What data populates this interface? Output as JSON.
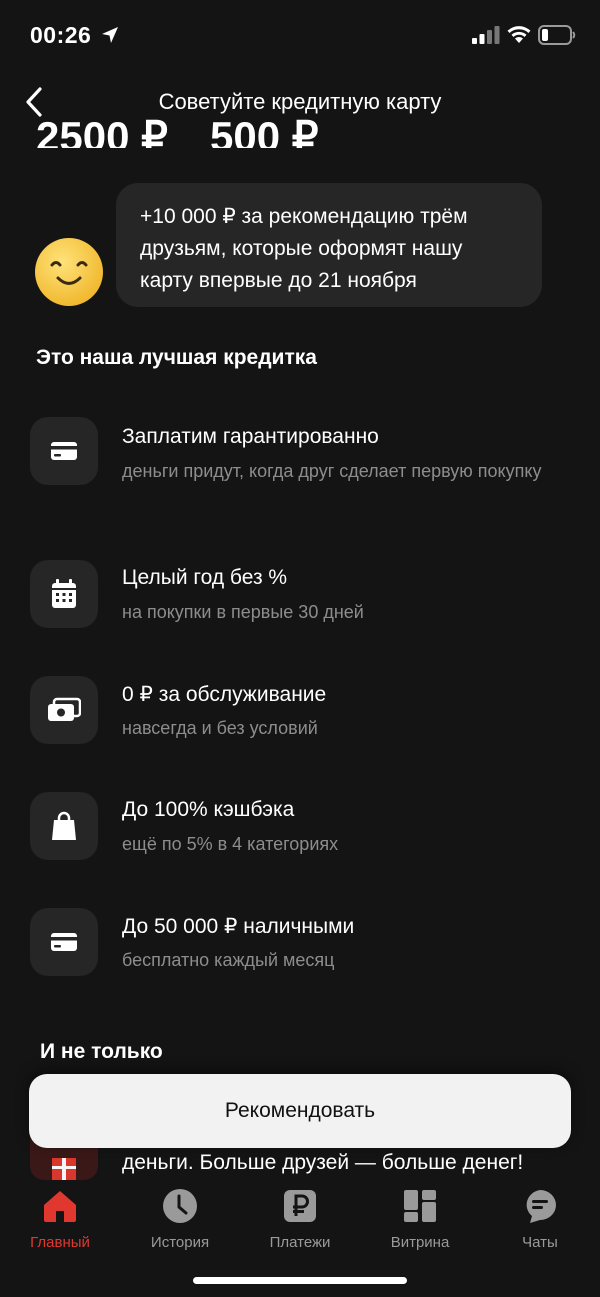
{
  "status": {
    "time": "00:26"
  },
  "nav": {
    "title": "Советуйте кредитную карту"
  },
  "amounts": {
    "left": "2500 ₽",
    "right": "500 ₽"
  },
  "promo": {
    "text": "+10 000 ₽ за рекомендацию трём друзьям, которые оформят нашу карту впервые до 21 ноября"
  },
  "section_title": "Это наша лучшая кредитка",
  "features": [
    {
      "icon": "card-icon",
      "title": "Заплатим гарантированно",
      "subtitle": "деньги придут, когда друг сделает первую покупку"
    },
    {
      "icon": "calendar-icon",
      "title": "Целый год без %",
      "subtitle": "на покупки в первые 30 дней"
    },
    {
      "icon": "cash-icon",
      "title": "0 ₽ за обслуживание",
      "subtitle": "навсегда и без условий"
    },
    {
      "icon": "shopping-bag-icon",
      "title": "До 100% кэшбэка",
      "subtitle": "ещё по 5% в 4 категориях"
    },
    {
      "icon": "card-icon",
      "title": "До 50 000 ₽ наличными",
      "subtitle": "бесплатно каждый месяц"
    }
  ],
  "section_title_2": "И не только",
  "partial_text": "деньги. Больше друзей — больше денег!",
  "cta": {
    "label": "Рекомендовать"
  },
  "tabs": [
    {
      "label": "Главный",
      "icon": "home-icon",
      "active": true
    },
    {
      "label": "История",
      "icon": "clock-icon",
      "active": false
    },
    {
      "label": "Платежи",
      "icon": "ruble-icon",
      "active": false
    },
    {
      "label": "Витрина",
      "icon": "showcase-icon",
      "active": false
    },
    {
      "label": "Чаты",
      "icon": "chat-icon",
      "active": false
    }
  ],
  "colors": {
    "background": "#141414",
    "card": "#262626",
    "accent": "#e0382f",
    "muted": "#8d8d8d",
    "button": "#f2f2f2"
  }
}
